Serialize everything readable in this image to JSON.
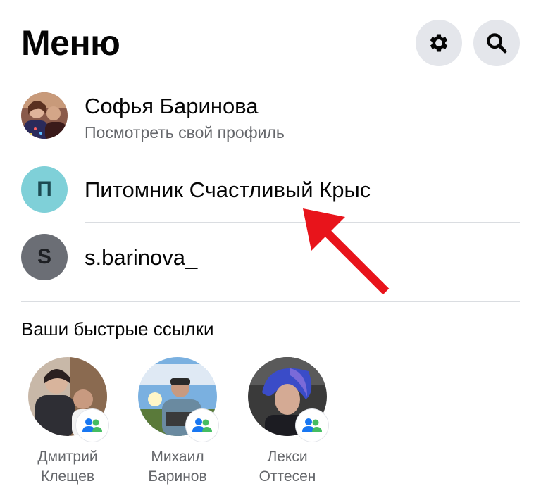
{
  "header": {
    "title": "Меню",
    "settings_icon": "gear-icon",
    "search_icon": "search-icon"
  },
  "profile": {
    "name": "Софья Баринова",
    "subtitle": "Посмотреть свой профиль"
  },
  "pages": [
    {
      "avatar_letter": "П",
      "name": "Питомник Счастливый Крыс",
      "avatar_color": "#7fd0d8",
      "letter_color": "#1c4a52"
    },
    {
      "avatar_letter": "S",
      "name": "s.barinova_",
      "avatar_color": "#6b6e75",
      "letter_color": "#1d1f23"
    }
  ],
  "shortcuts": {
    "title": "Ваши быстрые ссылки",
    "items": [
      {
        "name_line1": "Дмитрий",
        "name_line2": "Клещев"
      },
      {
        "name_line1": "Михаил",
        "name_line2": "Баринов"
      },
      {
        "name_line1": "Лекси",
        "name_line2": "Оттесен"
      }
    ]
  },
  "colors": {
    "accent": "#1877f2",
    "annotation_arrow": "#e8141b",
    "secondary_text": "#65676b",
    "button_bg": "#e4e6eb"
  }
}
